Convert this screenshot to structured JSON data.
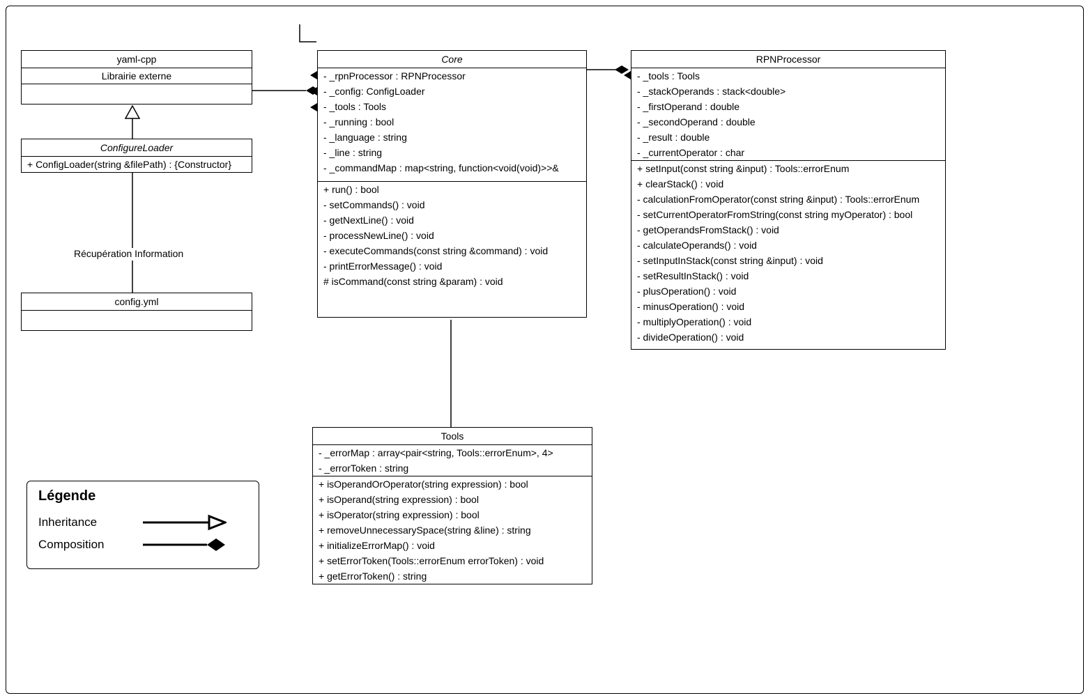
{
  "legend": {
    "title": "Légende",
    "inheritance": "Inheritance",
    "composition": "Composition"
  },
  "note_recup": "Récupération Information",
  "yamlcpp": {
    "title": "yaml-cpp",
    "attrs": [
      "Librairie externe"
    ]
  },
  "configyml": {
    "title": "config.yml"
  },
  "configloader": {
    "title": "ConfigureLoader",
    "attrs": [
      "+ ConfigLoader(string &filePath) : {Constructor}"
    ]
  },
  "core": {
    "title": "Core",
    "attrs": [
      "- _rpnProcessor : RPNProcessor",
      "- _config: ConfigLoader",
      "- _tools : Tools",
      "- _running : bool",
      "- _language : string",
      "- _line : string",
      "- _commandMap : map<string, function<void(void)>>&"
    ],
    "ops": [
      "+ run() : bool",
      "- setCommands() : void",
      "- getNextLine() : void",
      "- processNewLine() : void",
      "- executeCommands(const string &command) : void",
      "- printErrorMessage() : void",
      "# isCommand(const string &param) : void"
    ]
  },
  "rpn": {
    "title": "RPNProcessor",
    "attrs": [
      "- _tools : Tools",
      "- _stackOperands : stack<double>",
      "- _firstOperand : double",
      "- _secondOperand : double",
      "- _result : double",
      "- _currentOperator : char"
    ],
    "ops": [
      "+ setInput(const string &input) : Tools::errorEnum",
      "+ clearStack() : void",
      "- calculationFromOperator(const string &input) : Tools::errorEnum",
      "- setCurrentOperatorFromString(const string myOperator) : bool",
      "- getOperandsFromStack() : void",
      "- calculateOperands() : void",
      "- setInputInStack(const string &input) : void",
      "- setResultInStack() : void",
      "- plusOperation() : void",
      "- minusOperation() : void",
      "- multiplyOperation() : void",
      "- divideOperation() : void"
    ]
  },
  "tools": {
    "title": "Tools",
    "attrs": [
      "- _errorMap : array<pair<string, Tools::errorEnum>, 4>",
      "- _errorToken : string"
    ],
    "ops": [
      "+ isOperandOrOperator(string expression) : bool",
      "+ isOperand(string expression) : bool",
      "+ isOperator(string expression) : bool",
      "+ removeUnnecessarySpace(string &line) : string",
      "+ initializeErrorMap() : void",
      "+ setErrorToken(Tools::errorEnum errorToken) : void",
      "+ getErrorToken() : string"
    ]
  }
}
